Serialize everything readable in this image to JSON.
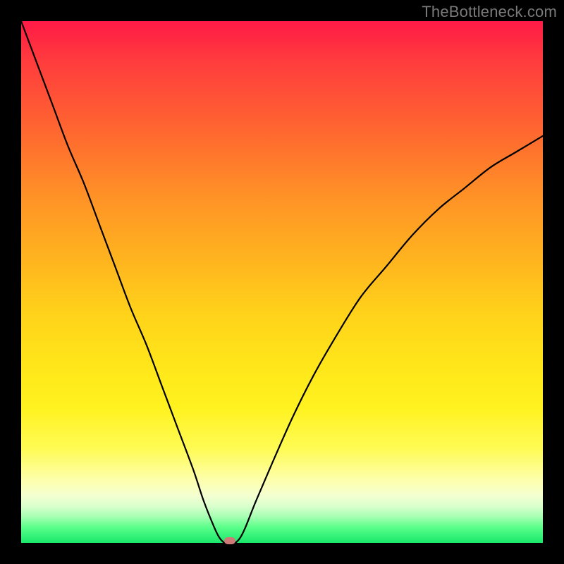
{
  "watermark": "TheBottleneck.com",
  "chart_data": {
    "type": "line",
    "title": "",
    "xlabel": "",
    "ylabel": "",
    "xlim": [
      0,
      100
    ],
    "ylim": [
      0,
      100
    ],
    "grid": false,
    "series": [
      {
        "name": "bottleneck-curve",
        "x": [
          0,
          3,
          6,
          9,
          12,
          15,
          18,
          21,
          24,
          27,
          30,
          33,
          35,
          37,
          38,
          39,
          40,
          41,
          42,
          43,
          45,
          48,
          52,
          56,
          60,
          65,
          70,
          75,
          80,
          85,
          90,
          95,
          100
        ],
        "y": [
          100,
          92,
          84,
          76,
          69,
          61,
          53,
          45,
          38,
          30,
          22,
          14,
          8,
          3,
          1,
          0,
          0,
          0,
          1,
          3,
          8,
          15,
          24,
          32,
          39,
          47,
          53,
          59,
          64,
          68,
          72,
          75,
          78
        ]
      }
    ],
    "minimum_marker": {
      "x": 40,
      "y": 0
    },
    "colors": {
      "curve": "#000000",
      "marker": "#cf7a78",
      "gradient_top": "#ff1a46",
      "gradient_bottom": "#18e86b",
      "frame": "#000000"
    }
  }
}
